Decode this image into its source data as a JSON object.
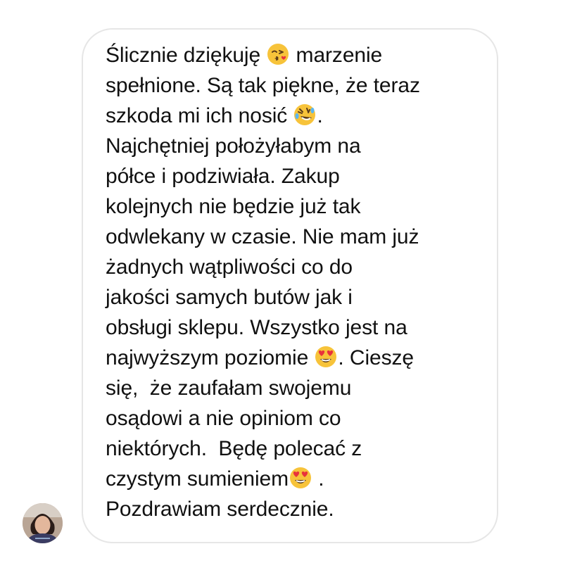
{
  "message": {
    "segments": [
      "Ślicznie dziękuję ",
      " marzenie",
      "spełnione. Są tak piękne, że teraz",
      "szkoda mi ich nosić ",
      ".",
      "Najchętniej położyłabym na",
      "półce i podziwiała. Zakup",
      "kolejnych nie będzie już tak",
      "odwlekany w czasie. Nie mam już",
      "żadnych wątpliwości co do",
      "jakości samych butów jak i",
      "obsługi sklepu. Wszystko jest na",
      "najwyższym poziomie ",
      ". Cieszę",
      "się,  że zaufałam swojemu",
      "osądowi a nie opiniom co",
      "niektórych.  Będę polecać z",
      "czystym sumieniem",
      " .",
      "Pozdrawiam serdecznie."
    ],
    "emojis": {
      "kiss": "face-blowing-kiss-icon",
      "rofl": "rolling-on-floor-laughing-icon",
      "heart_eyes": "smiling-face-heart-eyes-icon"
    }
  },
  "sender": {
    "avatar": "sender-avatar"
  },
  "colors": {
    "text": "#111111",
    "bubble_border": "#e6e6e6",
    "background": "#ffffff",
    "emoji_yellow": "#f7c33a",
    "heart_red": "#e8323c"
  }
}
